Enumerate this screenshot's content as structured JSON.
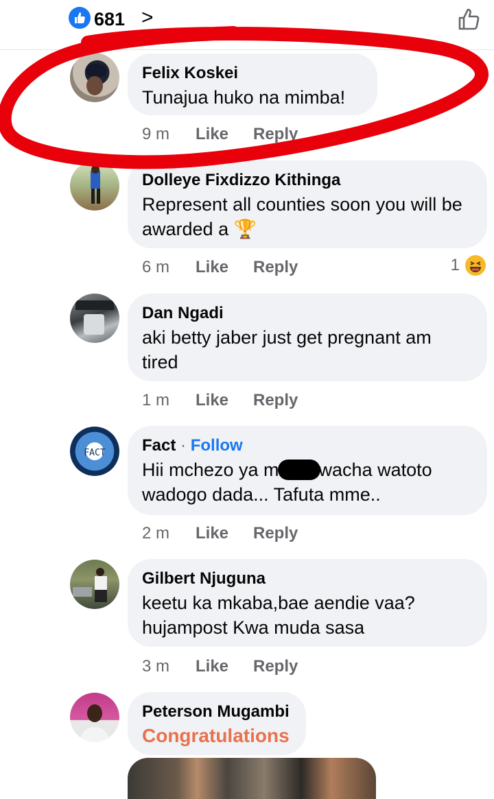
{
  "header": {
    "like_count": "681",
    "chevron": ">"
  },
  "comments": [
    {
      "author": "Felix Koskei",
      "text": "Tunajua huko na mimba!",
      "time": "9 m",
      "like": "Like",
      "reply": "Reply"
    },
    {
      "author": "Dolleye Fixdizzo Kithinga",
      "text": "Represent all counties soon you will be awarded a 🏆",
      "time": "6 m",
      "like": "Like",
      "reply": "Reply",
      "reaction_count": "1",
      "reaction_icon": "haha-emoji-icon"
    },
    {
      "author": "Dan Ngadi",
      "text": "aki betty jaber just get pregnant am tired",
      "time": "1 m",
      "like": "Like",
      "reply": "Reply"
    },
    {
      "author": "Fact",
      "separator": "·",
      "follow": "Follow",
      "text_before": "Hii mchezo ya m",
      "text_after": "wacha watoto wadogo dada... Tafuta mme..",
      "time": "2 m",
      "like": "Like",
      "reply": "Reply"
    },
    {
      "author": "Gilbert Njuguna",
      "text": "keetu ka mkaba,bae aendie vaa? hujampost Kwa muda sasa",
      "time": "3 m",
      "like": "Like",
      "reply": "Reply"
    },
    {
      "author": "Peterson Mugambi",
      "text": "Congratulations"
    }
  ],
  "fact_avatar_label": "FACT",
  "colors": {
    "bubble": "#f0f2f5",
    "link": "#1877f2",
    "meta": "#65676b",
    "annotation": "#e8000b",
    "congrats": "#e9714b"
  }
}
